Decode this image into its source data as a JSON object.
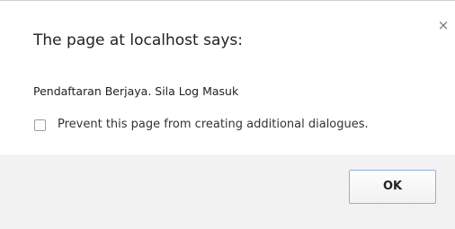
{
  "dialog": {
    "title": "The page at localhost says:",
    "message": "Pendaftaran Berjaya. Sila Log Masuk",
    "close_glyph": "×",
    "checkbox_label": "Prevent this page from creating additional dialogues.",
    "checkbox_checked": false,
    "ok_label": "OK",
    "icons": {
      "close": "close-icon",
      "checkbox": "checkbox-icon"
    },
    "colors": {
      "background": "#ffffff",
      "footer": "#f2f2f2",
      "ok_border": "#8fb0e0"
    }
  }
}
